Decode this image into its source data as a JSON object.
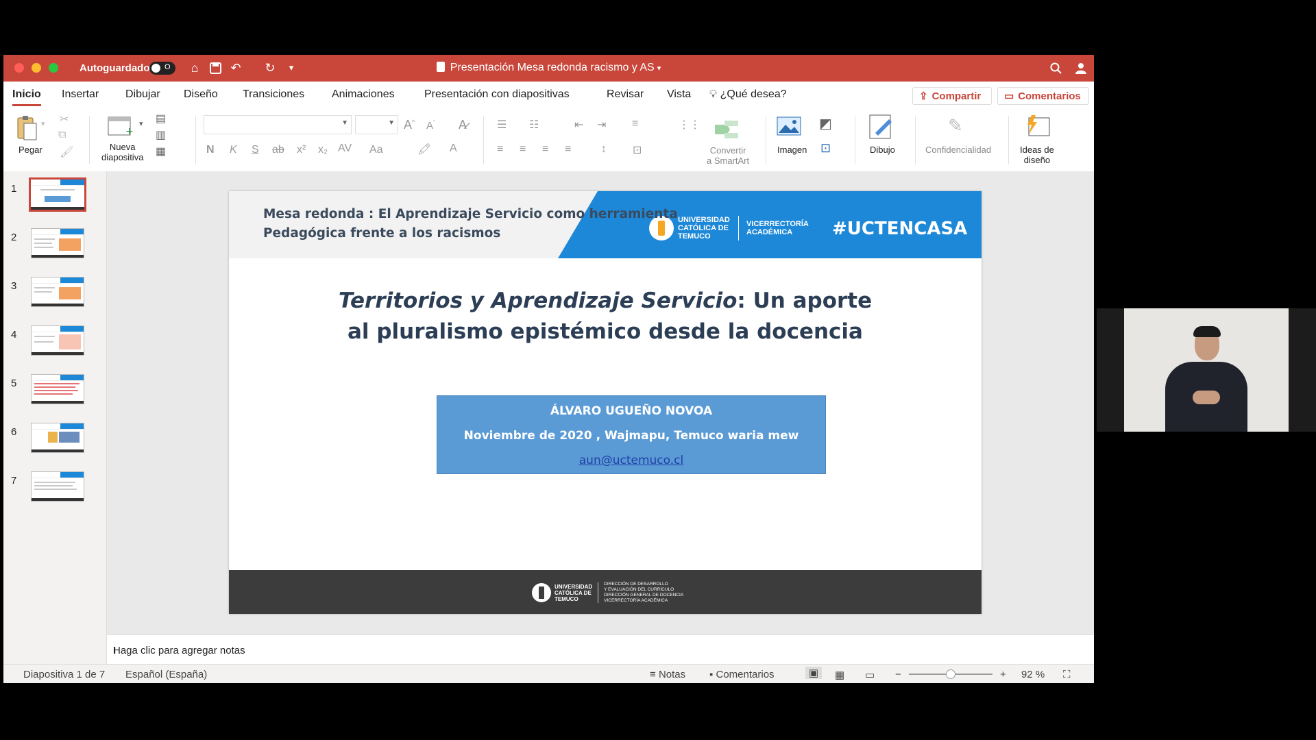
{
  "window": {
    "autosave_label": "Autoguardado",
    "autosave_state": "O",
    "doc_title": "Presentación Mesa redonda racismo y AS",
    "accent_color": "#c8463a"
  },
  "menu": {
    "tabs": [
      "Inicio",
      "Insertar",
      "Dibujar",
      "Diseño",
      "Transiciones",
      "Animaciones",
      "Presentación con diapositivas",
      "Revisar",
      "Vista"
    ],
    "tell_me": "¿Qué desea?",
    "share": "Compartir",
    "comments": "Comentarios"
  },
  "ribbon": {
    "paste": "Pegar",
    "new_slide_1": "Nueva",
    "new_slide_2": "diapositiva",
    "bold": "N",
    "italic": "K",
    "underline": "S",
    "strike": "ab",
    "superscript": "x²",
    "subscript": "x₂",
    "spacing": "AV",
    "case": "Aa",
    "convert_1": "Convertir",
    "convert_2": "a SmartArt",
    "image": "Imagen",
    "drawing": "Dibujo",
    "confidentiality": "Confidencialidad",
    "design_ideas_1": "Ideas de",
    "design_ideas_2": "diseño"
  },
  "thumbnails": [
    "1",
    "2",
    "3",
    "4",
    "5",
    "6",
    "7"
  ],
  "slide": {
    "header_line1": "Mesa redonda : El Aprendizaje Servicio como herramienta",
    "header_line2": "Pedagógica frente a los racismos",
    "univ_1": "UNIVERSIDAD",
    "univ_2": "CATÓLICA DE",
    "univ_3": "TEMUCO",
    "vicerrectoria_1": "VICERRECTORÍA",
    "vicerrectoria_2": "ACADÉMICA",
    "hashtag": "#UCTENCASA",
    "title_italic": "Territorios y Aprendizaje Servicio",
    "title_rest1": ": Un aporte",
    "title_line2": "al pluralismo epistémico desde la docencia",
    "author": "ÁLVARO UGUEÑO NOVOA",
    "date_place": "Noviembre de 2020 , Wajmapu, Temuco waria mew",
    "email": "aun@uctemuco.cl",
    "footer_univ_1": "UNIVERSIDAD",
    "footer_univ_2": "CATÓLICA DE",
    "footer_univ_3": "TEMUCO",
    "footer_dir_1": "DIRECCIÓN DE DESARROLLO",
    "footer_dir_2": "Y EVALUACIÓN DEL CURRÍCULO",
    "footer_dir_3": "DIRECCIÓN GENERAL DE DOCENCIA",
    "footer_dir_4": "VICERRECTORÍA ACADÉMICA",
    "band_color": "#1e88d8"
  },
  "notes": {
    "placeholder": "Haga clic para agregar notas"
  },
  "status": {
    "slide_count": "Diapositiva 1 de 7",
    "language": "Español (España)",
    "notes": "Notas",
    "comments": "Comentarios",
    "zoom": "92 %",
    "zoom_level": 0.5
  }
}
